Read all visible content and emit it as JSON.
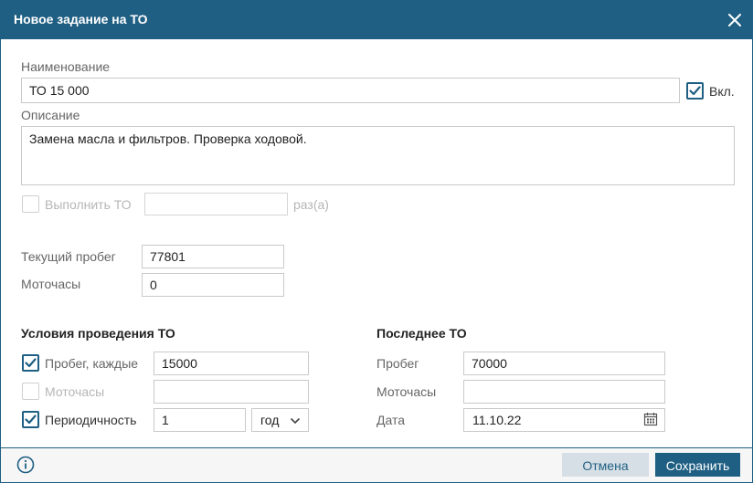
{
  "dialog": {
    "title": "Новое задание на ТО",
    "close_icon": "close-icon"
  },
  "name": {
    "label": "Наименование",
    "value": "ТО 15 000",
    "enabled_label": "Вкл.",
    "enabled_checked": true
  },
  "description": {
    "label": "Описание",
    "value": "Замена масла и фильтров. Проверка ходовой."
  },
  "repeat": {
    "label": "Выполнить ТО",
    "checked": false,
    "value": "",
    "suffix": "раз(а)"
  },
  "current": {
    "mileage_label": "Текущий пробег",
    "mileage_value": "77801",
    "motohours_label": "Моточасы",
    "motohours_value": "0"
  },
  "conditions": {
    "title": "Условия проведения ТО",
    "mileage_label": "Пробег, каждые",
    "mileage_checked": true,
    "mileage_value": "15000",
    "motohours_label": "Моточасы",
    "motohours_checked": false,
    "motohours_value": "",
    "period_label": "Периодичность",
    "period_checked": true,
    "period_value": "1",
    "period_unit": "год"
  },
  "last": {
    "title": "Последнее ТО",
    "mileage_label": "Пробег",
    "mileage_value": "70000",
    "motohours_label": "Моточасы",
    "motohours_value": "",
    "date_label": "Дата",
    "date_value": "11.10.22"
  },
  "footer": {
    "cancel_label": "Отмена",
    "save_label": "Сохранить",
    "info_icon": "info-icon"
  },
  "colors": {
    "accent": "#1f5f83",
    "cancel_bg": "#d6dfe5",
    "footer_bg": "#f6f6f6"
  }
}
